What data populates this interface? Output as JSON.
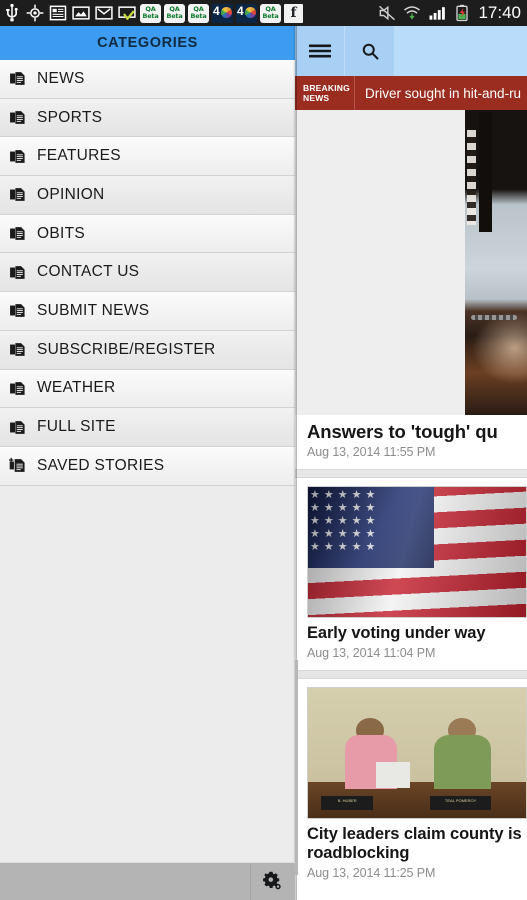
{
  "status_bar": {
    "icons": [
      {
        "name": "usb-icon",
        "glyph": "ψ"
      },
      {
        "name": "gps-location-icon",
        "glyph": "◎"
      },
      {
        "name": "news-app-icon",
        "glyph": "▤"
      },
      {
        "name": "gallery-photo-icon",
        "glyph": "⛰"
      },
      {
        "name": "gmail-icon",
        "glyph": "M"
      },
      {
        "name": "sms-check-icon",
        "glyph": "✔"
      }
    ],
    "qa_badges": [
      {
        "name": "qa-beta-notification-1",
        "line1": "QA",
        "line2": "Beta"
      },
      {
        "name": "qa-beta-notification-2",
        "line1": "QA",
        "line2": "Beta"
      },
      {
        "name": "qa-beta-notification-3",
        "line1": "QA",
        "line2": "Beta"
      },
      {
        "name": "qa-beta-notification-4",
        "line1": "QA",
        "line2": "Beta"
      }
    ],
    "nbc_badges": [
      {
        "name": "nbc4-notification-1",
        "label": "4"
      },
      {
        "name": "nbc4-notification-2",
        "label": "4"
      }
    ],
    "facebook": {
      "name": "facebook-icon",
      "label": "f"
    },
    "right_icons": [
      {
        "name": "mute-vibrate-icon",
        "glyph": "⫢"
      },
      {
        "name": "wifi-icon",
        "glyph": "▲"
      },
      {
        "name": "signal-bars-icon",
        "glyph": "▂"
      },
      {
        "name": "battery-charging-icon",
        "glyph": "▮"
      }
    ],
    "clock": "17:40"
  },
  "drawer": {
    "title": "CATEGORIES",
    "title_bg": "#3d9bf0",
    "items": [
      {
        "label": "NEWS",
        "icon": "document-icon"
      },
      {
        "label": "SPORTS",
        "icon": "document-icon"
      },
      {
        "label": "FEATURES",
        "icon": "document-icon"
      },
      {
        "label": "OPINION",
        "icon": "document-icon"
      },
      {
        "label": "OBITS",
        "icon": "document-icon"
      },
      {
        "label": "CONTACT US",
        "icon": "document-icon"
      },
      {
        "label": "SUBMIT NEWS",
        "icon": "document-icon"
      },
      {
        "label": "SUBSCRIBE/REGISTER",
        "icon": "document-icon"
      },
      {
        "label": "WEATHER",
        "icon": "document-icon"
      },
      {
        "label": "FULL SITE",
        "icon": "document-icon"
      },
      {
        "label": "SAVED STORIES",
        "icon": "document-add-icon"
      }
    ]
  },
  "system_nav": {
    "settings": {
      "name": "settings-gear-icon",
      "label": "Settings"
    }
  },
  "content": {
    "app_bar": {
      "menu": {
        "name": "hamburger-menu-icon",
        "label": "Menu"
      },
      "search": {
        "name": "search-icon",
        "label": "Search"
      },
      "bg": "#afd6f7"
    },
    "breaking": {
      "tag_line1": "BREAKING",
      "tag_line2": "NEWS",
      "headline": "Driver sought in hit-and-ru",
      "bg": "#9b2d20"
    },
    "feed": [
      {
        "title": "Answers to 'tough' qu",
        "date": "Aug 13, 2014 11:55 PM",
        "image": "courtroom-shackled-defendant-photo"
      },
      {
        "title": "Early voting under way",
        "date": "Aug 13, 2014 11:04 PM",
        "image": "american-flag-photo"
      },
      {
        "title": "City leaders claim county is\nroadblocking",
        "date": "Aug 13, 2014 11:25 PM",
        "image": "city-council-meeting-photo",
        "plate1": "B. HUBER",
        "plate2": "TEAL POMEROY"
      }
    ]
  }
}
